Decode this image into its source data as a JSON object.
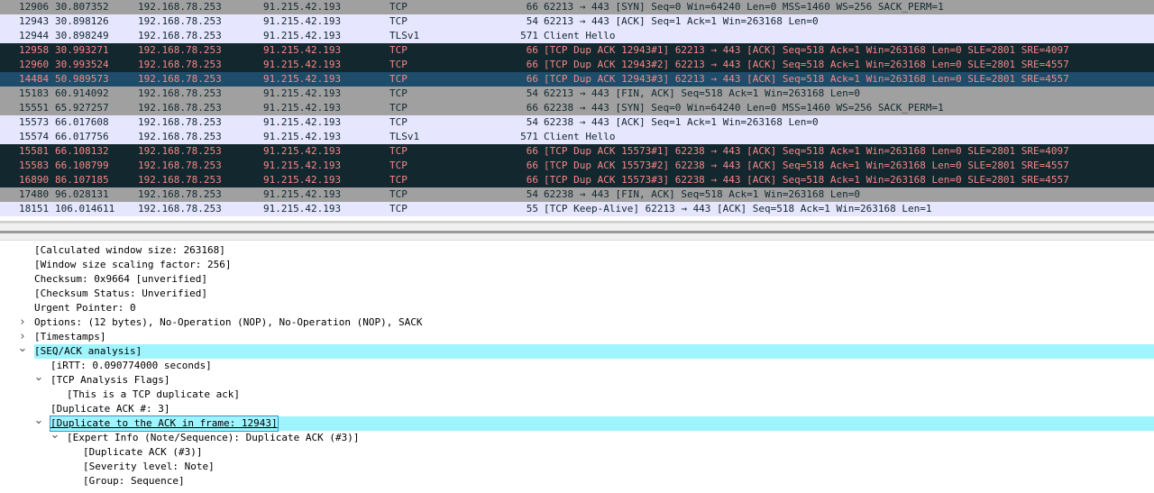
{
  "packets": [
    {
      "no": "12906",
      "time": "30.807352",
      "src": "192.168.78.253",
      "dst": "91.215.42.193",
      "proto": "TCP",
      "len": "66",
      "info": "62213 → 443 [SYN] Seq=0 Win=64240 Len=0 MSS=1460 WS=256 SACK_PERM=1",
      "style": "gray"
    },
    {
      "no": "12943",
      "time": "30.898126",
      "src": "192.168.78.253",
      "dst": "91.215.42.193",
      "proto": "TCP",
      "len": "54",
      "info": "62213 → 443 [ACK] Seq=1 Ack=1 Win=263168 Len=0",
      "style": "light"
    },
    {
      "no": "12944",
      "time": "30.898249",
      "src": "192.168.78.253",
      "dst": "91.215.42.193",
      "proto": "TLSv1",
      "len": "571",
      "info": "Client Hello",
      "style": "light"
    },
    {
      "no": "12958",
      "time": "30.993271",
      "src": "192.168.78.253",
      "dst": "91.215.42.193",
      "proto": "TCP",
      "len": "66",
      "info": "[TCP Dup ACK 12943#1] 62213 → 443 [ACK] Seq=518 Ack=1 Win=263168 Len=0 SLE=2801 SRE=4097",
      "style": "dark"
    },
    {
      "no": "12960",
      "time": "30.993524",
      "src": "192.168.78.253",
      "dst": "91.215.42.193",
      "proto": "TCP",
      "len": "66",
      "info": "[TCP Dup ACK 12943#2] 62213 → 443 [ACK] Seq=518 Ack=1 Win=263168 Len=0 SLE=2801 SRE=4557",
      "style": "dark"
    },
    {
      "no": "14484",
      "time": "50.989573",
      "src": "192.168.78.253",
      "dst": "91.215.42.193",
      "proto": "TCP",
      "len": "66",
      "info": "[TCP Dup ACK 12943#3] 62213 → 443 [ACK] Seq=518 Ack=1 Win=263168 Len=0 SLE=2801 SRE=4557",
      "style": "selected"
    },
    {
      "no": "15183",
      "time": "60.914092",
      "src": "192.168.78.253",
      "dst": "91.215.42.193",
      "proto": "TCP",
      "len": "54",
      "info": "62213 → 443 [FIN, ACK] Seq=518 Ack=1 Win=263168 Len=0",
      "style": "gray"
    },
    {
      "no": "15551",
      "time": "65.927257",
      "src": "192.168.78.253",
      "dst": "91.215.42.193",
      "proto": "TCP",
      "len": "66",
      "info": "62238 → 443 [SYN] Seq=0 Win=64240 Len=0 MSS=1460 WS=256 SACK_PERM=1",
      "style": "gray"
    },
    {
      "no": "15573",
      "time": "66.017608",
      "src": "192.168.78.253",
      "dst": "91.215.42.193",
      "proto": "TCP",
      "len": "54",
      "info": "62238 → 443 [ACK] Seq=1 Ack=1 Win=263168 Len=0",
      "style": "light"
    },
    {
      "no": "15574",
      "time": "66.017756",
      "src": "192.168.78.253",
      "dst": "91.215.42.193",
      "proto": "TLSv1",
      "len": "571",
      "info": "Client Hello",
      "style": "light"
    },
    {
      "no": "15581",
      "time": "66.108132",
      "src": "192.168.78.253",
      "dst": "91.215.42.193",
      "proto": "TCP",
      "len": "66",
      "info": "[TCP Dup ACK 15573#1] 62238 → 443 [ACK] Seq=518 Ack=1 Win=263168 Len=0 SLE=2801 SRE=4097",
      "style": "dark"
    },
    {
      "no": "15583",
      "time": "66.108799",
      "src": "192.168.78.253",
      "dst": "91.215.42.193",
      "proto": "TCP",
      "len": "66",
      "info": "[TCP Dup ACK 15573#2] 62238 → 443 [ACK] Seq=518 Ack=1 Win=263168 Len=0 SLE=2801 SRE=4557",
      "style": "dark"
    },
    {
      "no": "16890",
      "time": "86.107185",
      "src": "192.168.78.253",
      "dst": "91.215.42.193",
      "proto": "TCP",
      "len": "66",
      "info": "[TCP Dup ACK 15573#3] 62238 → 443 [ACK] Seq=518 Ack=1 Win=263168 Len=0 SLE=2801 SRE=4557",
      "style": "dark"
    },
    {
      "no": "17480",
      "time": "96.028131",
      "src": "192.168.78.253",
      "dst": "91.215.42.193",
      "proto": "TCP",
      "len": "54",
      "info": "62238 → 443 [FIN, ACK] Seq=518 Ack=1 Win=263168 Len=0",
      "style": "gray"
    },
    {
      "no": "18151",
      "time": "106.014611",
      "src": "192.168.78.253",
      "dst": "91.215.42.193",
      "proto": "TCP",
      "len": "55",
      "info": "[TCP Keep-Alive] 62213 → 443 [ACK] Seq=518 Ack=1 Win=263168 Len=1",
      "style": "light"
    }
  ],
  "details": [
    {
      "text": "[Calculated window size: 263168]",
      "level": 1,
      "toggle": "none",
      "hl": false
    },
    {
      "text": "[Window size scaling factor: 256]",
      "level": 1,
      "toggle": "none",
      "hl": false
    },
    {
      "text": "Checksum: 0x9664 [unverified]",
      "level": 1,
      "toggle": "none",
      "hl": false
    },
    {
      "text": "[Checksum Status: Unverified]",
      "level": 1,
      "toggle": "none",
      "hl": false
    },
    {
      "text": "Urgent Pointer: 0",
      "level": 1,
      "toggle": "none",
      "hl": false
    },
    {
      "text": "Options: (12 bytes), No-Operation (NOP), No-Operation (NOP), SACK",
      "level": 1,
      "toggle": "collapsed",
      "hl": false
    },
    {
      "text": "[Timestamps]",
      "level": 1,
      "toggle": "collapsed",
      "hl": false
    },
    {
      "text": "[SEQ/ACK analysis]",
      "level": 1,
      "toggle": "expanded",
      "hl": true
    },
    {
      "text": "[iRTT: 0.090774000 seconds]",
      "level": 2,
      "toggle": "none",
      "hl": false
    },
    {
      "text": "[TCP Analysis Flags]",
      "level": 2,
      "toggle": "expanded",
      "hl": false
    },
    {
      "text": "[This is a TCP duplicate ack]",
      "level": 3,
      "toggle": "none",
      "hl": false
    },
    {
      "text": "[Duplicate ACK #: 3]",
      "level": 2,
      "toggle": "none",
      "hl": false
    },
    {
      "text": "[Duplicate to the ACK in frame: 12943]",
      "level": 2,
      "toggle": "expanded",
      "hl": true,
      "link": true
    },
    {
      "text": "[Expert Info (Note/Sequence): Duplicate ACK (#3)]",
      "level": 3,
      "toggle": "expanded",
      "hl": false
    },
    {
      "text": "[Duplicate ACK (#3)]",
      "level": 4,
      "toggle": "none",
      "hl": false
    },
    {
      "text": "[Severity level: Note]",
      "level": 4,
      "toggle": "none",
      "hl": false
    },
    {
      "text": "[Group: Sequence]",
      "level": 4,
      "toggle": "none",
      "hl": false
    }
  ],
  "colors": {
    "light_row": "#e7e6ff",
    "gray_row": "#a0a0a0",
    "dark_row": "#12272e",
    "dark_row_text": "#f78787",
    "selected_row": "#1d4d6b",
    "tree_highlight": "#9ff5ff"
  }
}
